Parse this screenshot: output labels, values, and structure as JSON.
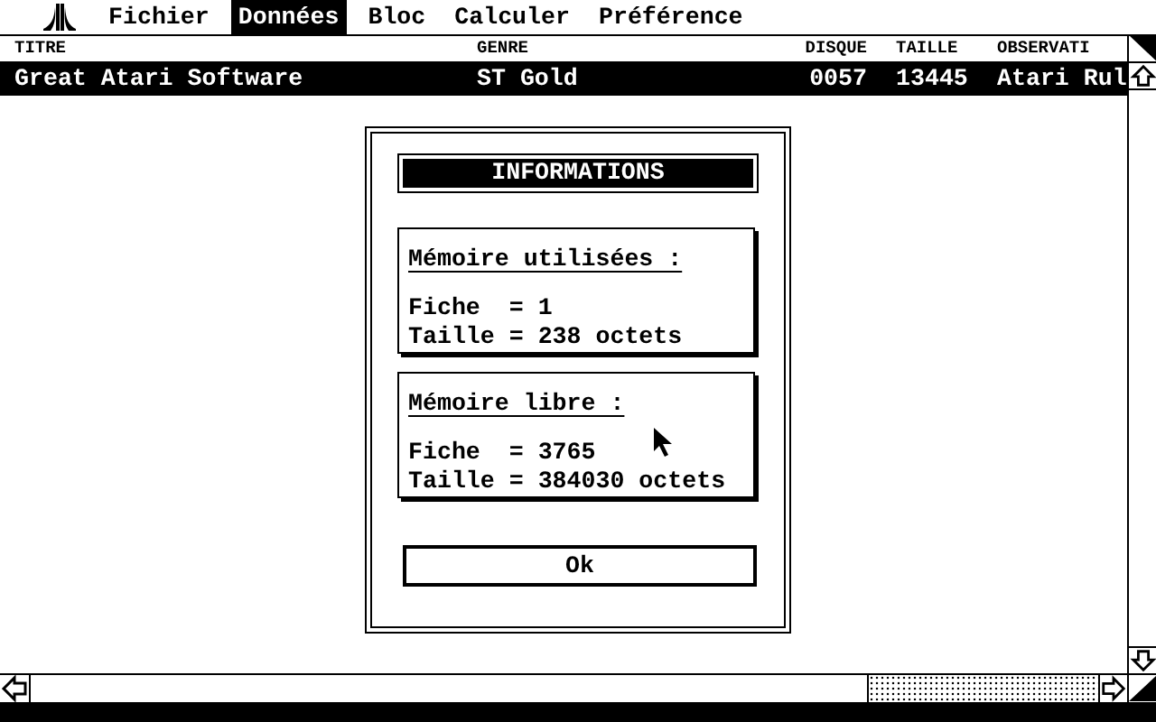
{
  "menu_bar": {
    "items": [
      {
        "label": "Fichier",
        "selected": false
      },
      {
        "label": "Données",
        "selected": true
      },
      {
        "label": "Bloc",
        "selected": false
      },
      {
        "label": "Calculer",
        "selected": false
      },
      {
        "label": "Préférence",
        "selected": false
      }
    ]
  },
  "table": {
    "columns": [
      "TITRE",
      "GENRE",
      "DISQUE",
      "TAILLE",
      "OBSERVATI"
    ],
    "rows": [
      {
        "cells": [
          "Great Atari Software",
          "ST Gold",
          "0057",
          "13445",
          "Atari Rul"
        ],
        "selected": true
      }
    ]
  },
  "dialog": {
    "title": "INFORMATIONS",
    "sections": [
      {
        "heading": "Mémoire utilisées :",
        "lines": [
          "Fiche  = 1",
          "Taille = 238 octets"
        ]
      },
      {
        "heading": "Mémoire libre :",
        "lines": [
          "Fiche  = 3765",
          "Taille = 384030 octets"
        ]
      }
    ],
    "button": "Ok"
  }
}
